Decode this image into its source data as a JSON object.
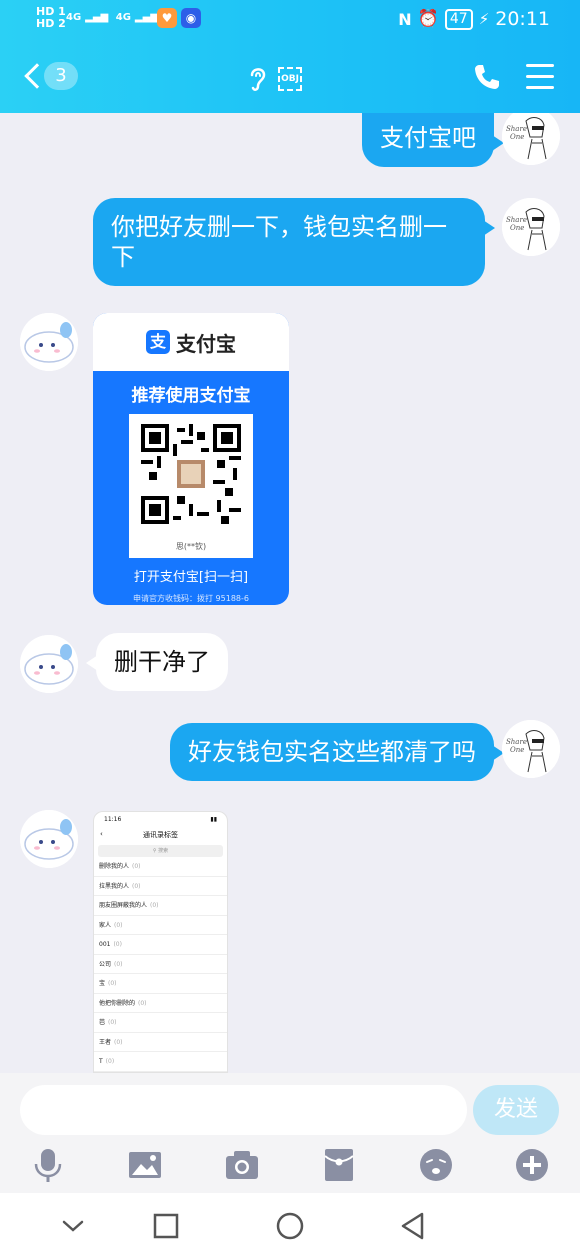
{
  "status_bar": {
    "hd1": "HD 1",
    "hd2": "HD 2",
    "net1": "4G",
    "net2": "4G",
    "battery": "47",
    "time": "20:11"
  },
  "header": {
    "back_count": "3",
    "obj_label": "OBJ"
  },
  "messages": {
    "m1": "支付宝吧",
    "m2": "你把好友删一下，钱包实名删一下",
    "m4": "删干净了",
    "m5": "好友钱包实名这些都清了吗"
  },
  "alipay_card": {
    "brand": "支付宝",
    "logo_char": "支",
    "recommend": "推荐使用支付宝",
    "name": "思(**钦)",
    "open": "打开支付宝[扫一扫]",
    "apply": "申请官方收钱码：拨打 95188-6"
  },
  "screenshot_thumb": {
    "time": "11:16",
    "title": "通讯录标签",
    "search": "搜索",
    "rows": [
      {
        "label": "删除我的人",
        "count": "(0)"
      },
      {
        "label": "拉黑我的人",
        "count": "(0)"
      },
      {
        "label": "朋友圈屏蔽我的人",
        "count": "(0)"
      },
      {
        "label": "家人",
        "count": "(0)"
      },
      {
        "label": "001",
        "count": "(0)"
      },
      {
        "label": "公司",
        "count": "(0)"
      },
      {
        "label": "宝",
        "count": "(0)"
      },
      {
        "label": "他把你删除的",
        "count": "(0)"
      },
      {
        "label": "芭",
        "count": "(0)"
      },
      {
        "label": "王者",
        "count": "(0)"
      },
      {
        "label": "T",
        "count": "(0)"
      }
    ]
  },
  "input_bar": {
    "placeholder": "",
    "send_label": "发送"
  },
  "colors": {
    "header_start": "#2bd0f5",
    "header_end": "#17b6f6",
    "bubble_out": "#1ba7f1",
    "alipay_blue": "#1677ff",
    "icon_gray": "#8a8fa3"
  }
}
